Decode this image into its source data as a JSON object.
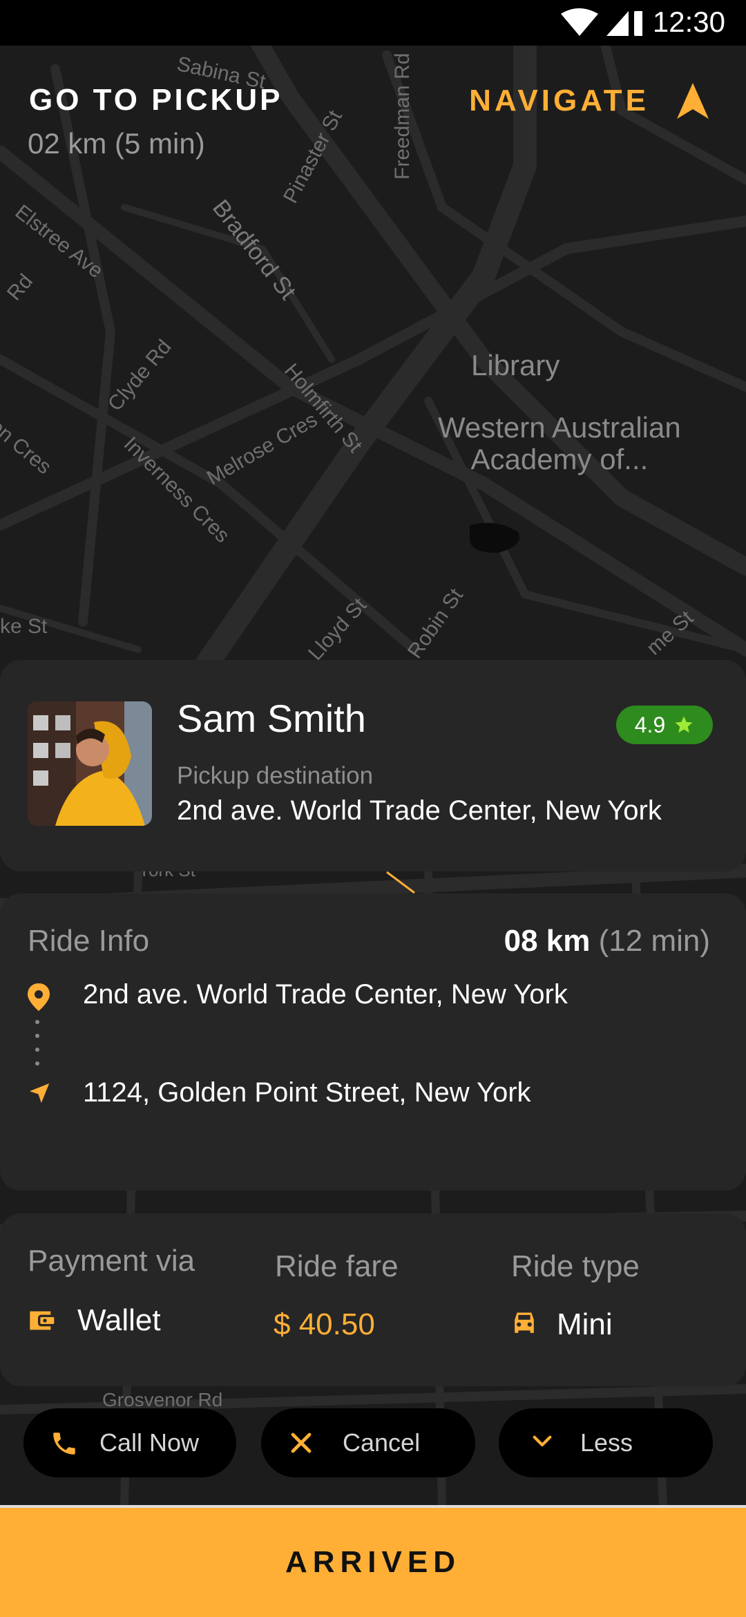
{
  "status_bar": {
    "time": "12:30"
  },
  "header": {
    "title": "GO TO PICKUP",
    "subtitle": "02 km (5 min)",
    "navigate_label": "NAVIGATE"
  },
  "map": {
    "streets": [
      "Bradford St",
      "Elstree Ave",
      "Clyde Rd",
      "Inverness Cres",
      "Melrose Cres",
      "Holmfirth St",
      "Pinaster St",
      "Freedman Rd",
      "Sabina St",
      "Robin St",
      "Lloyd St",
      "on Cres",
      "Rd",
      "ke St",
      "me St",
      "Grosvenor Rd",
      "York St"
    ],
    "pois": [
      "Library",
      "Western Australian\nAcademy of..."
    ]
  },
  "rider": {
    "name": "Sam Smith",
    "rating": "4.9",
    "pickup_label": "Pickup destination",
    "pickup_address": "2nd ave. World Trade Center, New York"
  },
  "ride": {
    "label": "Ride Info",
    "distance": "08 km",
    "duration": "(12 min)",
    "from": "2nd ave. World Trade Center, New York",
    "to": "1124, Golden Point Street, New York"
  },
  "payment": {
    "via_label": "Payment via",
    "via_value": "Wallet",
    "fare_label": "Ride fare",
    "fare_value": "$ 40.50",
    "type_label": "Ride type",
    "type_value": "Mini"
  },
  "actions": {
    "call": "Call Now",
    "cancel": "Cancel",
    "less": "Less"
  },
  "primary_action": "ARRIVED",
  "colors": {
    "accent": "#FFAF36",
    "rating_bg": "#2E8B1D",
    "card_bg": "#262626"
  },
  "icons": [
    "wifi-icon",
    "signal-icon",
    "battery-icon",
    "navigate-arrow-icon",
    "star-icon",
    "location-pin-icon",
    "route-arrow-icon",
    "wallet-icon",
    "car-icon",
    "phone-icon",
    "close-icon",
    "chevron-down-icon"
  ]
}
